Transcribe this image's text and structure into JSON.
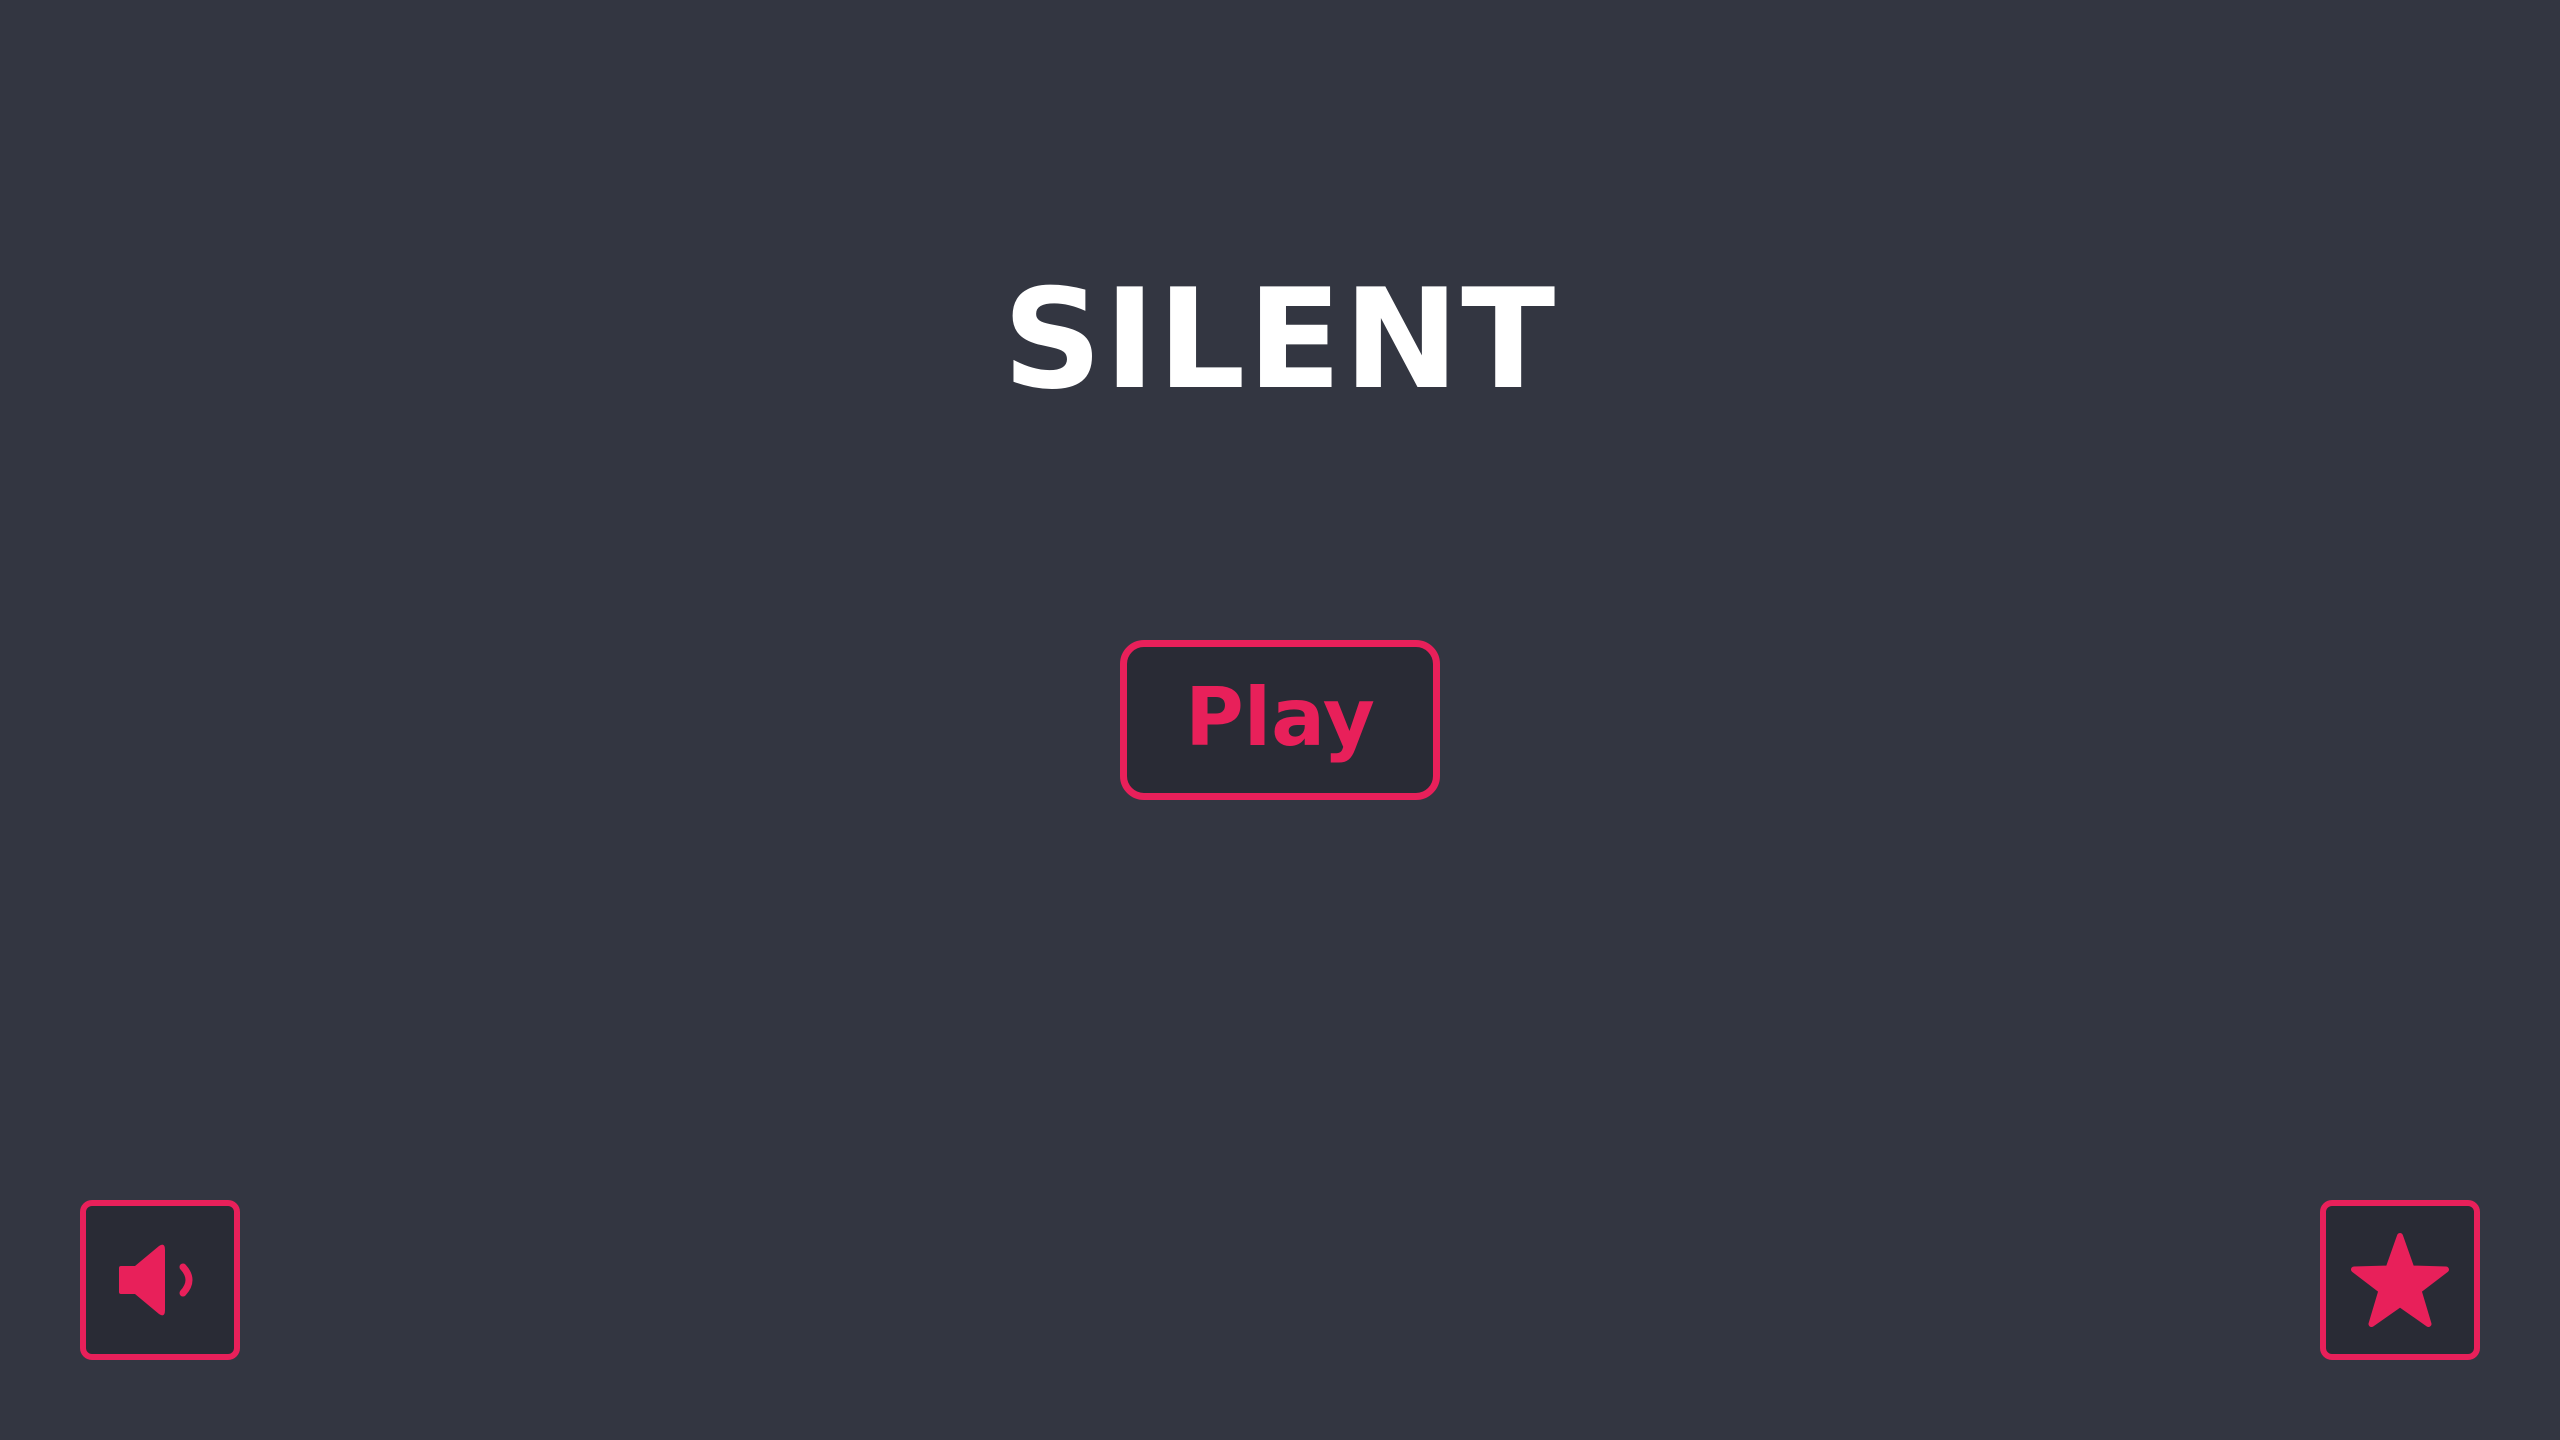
{
  "title": "SILENT",
  "play_button": {
    "label": "Play"
  },
  "sound_button": {
    "icon": "speaker-icon"
  },
  "favorites_button": {
    "icon": "star-icon"
  },
  "colors": {
    "background": "#333641",
    "button_background": "#292b35",
    "accent": "#e8205a",
    "title": "#ffffff"
  }
}
